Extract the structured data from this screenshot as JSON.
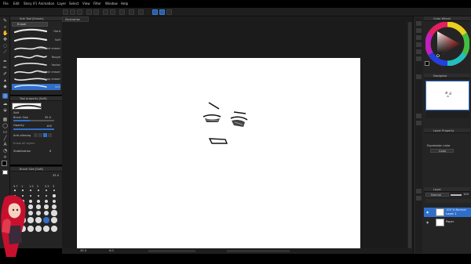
{
  "menu": [
    "File",
    "Edit",
    "Story (F)",
    "Animation",
    "Layer",
    "Select",
    "View",
    "Filter",
    "Window",
    "Help"
  ],
  "left_tools": [
    "pen-icon",
    "magnifier-icon",
    "hand-icon",
    "move-icon",
    "lasso-icon",
    "eyedropper-icon",
    "pen-icon",
    "brush-icon",
    "airbrush-icon",
    "eraser-icon",
    "blend-icon",
    "fill-icon",
    "gradient-icon",
    "figure-icon",
    "frame-icon",
    "text-icon",
    "balloon-icon",
    "ruler-icon"
  ],
  "sub_tool": {
    "title": "Sub Tool [Eraser]",
    "group": "Eraser",
    "brushes": [
      "Hard",
      "Soft",
      "Kneaded eraser",
      "Rough",
      "Vector",
      "Rubbish eraser",
      "Snap eraser",
      "Soft"
    ],
    "selected_index": 7
  },
  "tool_property": {
    "title": "Tool property [Soft]",
    "brush_name": "Soft",
    "brush_size_label": "Brush Size",
    "brush_size_value": "35.0",
    "opacity_label": "Opacity",
    "opacity_value": "100",
    "antialias_label": "Anti-aliasing",
    "erase_label": "Erase all layers",
    "stabilization_label": "Stabilization",
    "stabilization_value": "6"
  },
  "brush_size": {
    "title": "Brush Size [Soft]",
    "value": "35.0",
    "sizes": [
      "0.7",
      "1",
      "1.5",
      "2",
      "2.5",
      "3"
    ]
  },
  "document": {
    "tab_label": "Illustration"
  },
  "status": {
    "zoom": "33.3",
    "angle": "0.0"
  },
  "right": {
    "color_wheel_title": "Color Wheel",
    "navigator_title": "Navigator",
    "layer_property_title": "Layer Property",
    "expression_color_label": "Expression color",
    "expression_color_value": "Color",
    "layer_title": "Layer",
    "blend_mode": "Normal",
    "opacity": "100",
    "layers": [
      {
        "percent": "100 % Normal",
        "name": "Layer 1"
      },
      {
        "percent": "",
        "name": "Paper"
      }
    ]
  },
  "colors": {
    "accent": "#2f6fc9",
    "main_color": "#000000",
    "sub_color": "#ffffff"
  }
}
